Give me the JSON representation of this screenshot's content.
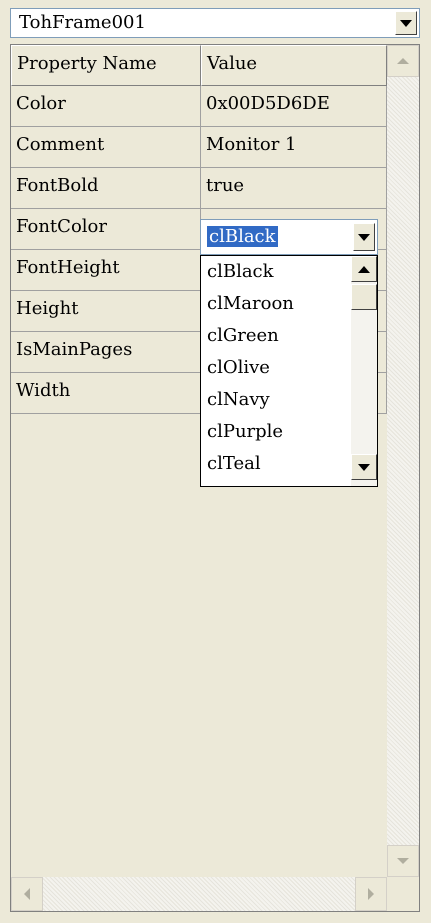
{
  "object_selector": {
    "value": "TohFrame001"
  },
  "grid": {
    "headers": {
      "name": "Property Name",
      "value": "Value"
    },
    "rows": [
      {
        "name": "Color",
        "value": "0x00D5D6DE"
      },
      {
        "name": "Comment",
        "value": "Monitor 1"
      },
      {
        "name": "FontBold",
        "value": "true"
      },
      {
        "name": "FontColor",
        "value": ""
      },
      {
        "name": "FontHeight",
        "value": ""
      },
      {
        "name": "Height",
        "value": ""
      },
      {
        "name": "IsMainPages",
        "value": ""
      },
      {
        "name": "Width",
        "value": ""
      }
    ]
  },
  "fontcolor_editor": {
    "selected": "clBlack",
    "options": [
      "clBlack",
      "clMaroon",
      "clGreen",
      "clOlive",
      "clNavy",
      "clPurple",
      "clTeal"
    ]
  },
  "colors": {
    "selection": "#316ac5",
    "background": "#ece9d8"
  }
}
